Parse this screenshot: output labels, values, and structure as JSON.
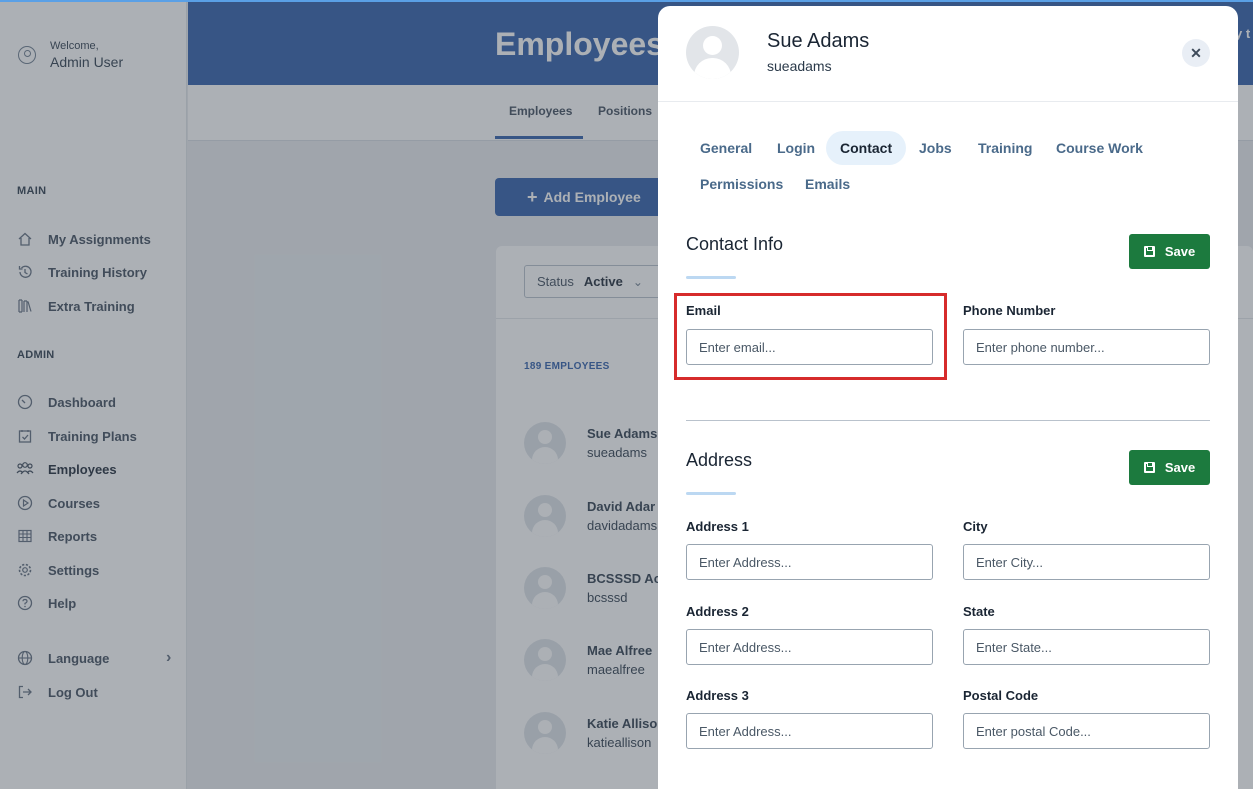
{
  "sidebar": {
    "welcome_small": "Welcome,",
    "welcome_name": "Admin User",
    "main_label": "MAIN",
    "admin_label": "ADMIN",
    "main_items": [
      {
        "label": "My Assignments",
        "icon": "home-icon"
      },
      {
        "label": "Training History",
        "icon": "history-icon"
      },
      {
        "label": "Extra Training",
        "icon": "books-icon"
      }
    ],
    "admin_items": [
      {
        "label": "Dashboard",
        "icon": "gauge-icon"
      },
      {
        "label": "Training Plans",
        "icon": "checklist-icon"
      },
      {
        "label": "Employees",
        "icon": "people-icon"
      },
      {
        "label": "Courses",
        "icon": "play-icon"
      },
      {
        "label": "Reports",
        "icon": "grid-icon"
      },
      {
        "label": "Settings",
        "icon": "gear-icon"
      },
      {
        "label": "Help",
        "icon": "help-icon"
      }
    ],
    "language_label": "Language",
    "logout_label": "Log Out"
  },
  "header": {
    "title": "Employees",
    "right_text": "y t"
  },
  "main_tabs": [
    "Employees",
    "Positions"
  ],
  "add_button_label": "Add Employee",
  "filter": {
    "status_label": "Status",
    "status_value": "Active"
  },
  "employee_count": "189 EMPLOYEES",
  "employees": [
    {
      "name": "Sue Adams",
      "username": "sueadams"
    },
    {
      "name": "David Adar",
      "username": "davidadams"
    },
    {
      "name": "BCSSSD Ac",
      "username": "bcsssd"
    },
    {
      "name": "Mae Alfree",
      "username": "maealfree"
    },
    {
      "name": "Katie Alliso",
      "username": "katieallison"
    }
  ],
  "panel": {
    "name": "Sue Adams",
    "username": "sueadams",
    "close_symbol": "✕",
    "tabs": [
      "General",
      "Login",
      "Contact",
      "Jobs",
      "Training",
      "Course Work",
      "Permissions",
      "Emails"
    ],
    "active_tab": "Contact",
    "contact": {
      "title": "Contact Info",
      "save_label": "Save",
      "email_label": "Email",
      "email_placeholder": "Enter email...",
      "phone_label": "Phone Number",
      "phone_placeholder": "Enter phone number..."
    },
    "address": {
      "title": "Address",
      "save_label": "Save",
      "address1_label": "Address 1",
      "address1_placeholder": "Enter Address...",
      "city_label": "City",
      "city_placeholder": "Enter City...",
      "address2_label": "Address 2",
      "address2_placeholder": "Enter Address...",
      "state_label": "State",
      "state_placeholder": "Enter State...",
      "address3_label": "Address 3",
      "address3_placeholder": "Enter Address...",
      "postal_label": "Postal Code",
      "postal_placeholder": "Enter postal Code..."
    }
  },
  "colors": {
    "header_blue": "#2a5aa8",
    "save_green": "#1c7a3e",
    "highlight_red": "#d62b2b",
    "active_tab_bg": "#e6f1fb"
  }
}
